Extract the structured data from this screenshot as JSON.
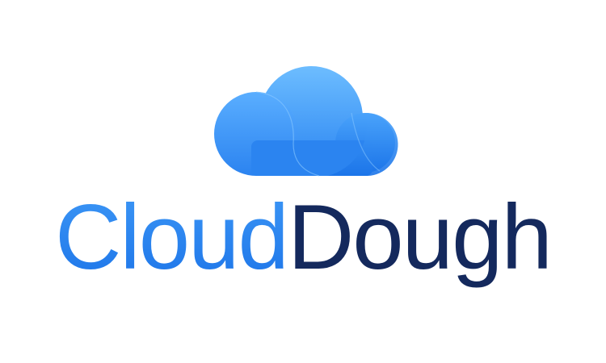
{
  "logo": {
    "brand_part_1": "Cloud",
    "brand_part_2": "Dough",
    "icon": "cloud-icon"
  },
  "colors": {
    "background": "#ffffff",
    "cloud_light": "#6cbcff",
    "cloud_mid": "#3f9af7",
    "cloud_dark": "#1a73e8",
    "wordmark_blue": "#2f86f0",
    "wordmark_navy": "#14295d"
  }
}
